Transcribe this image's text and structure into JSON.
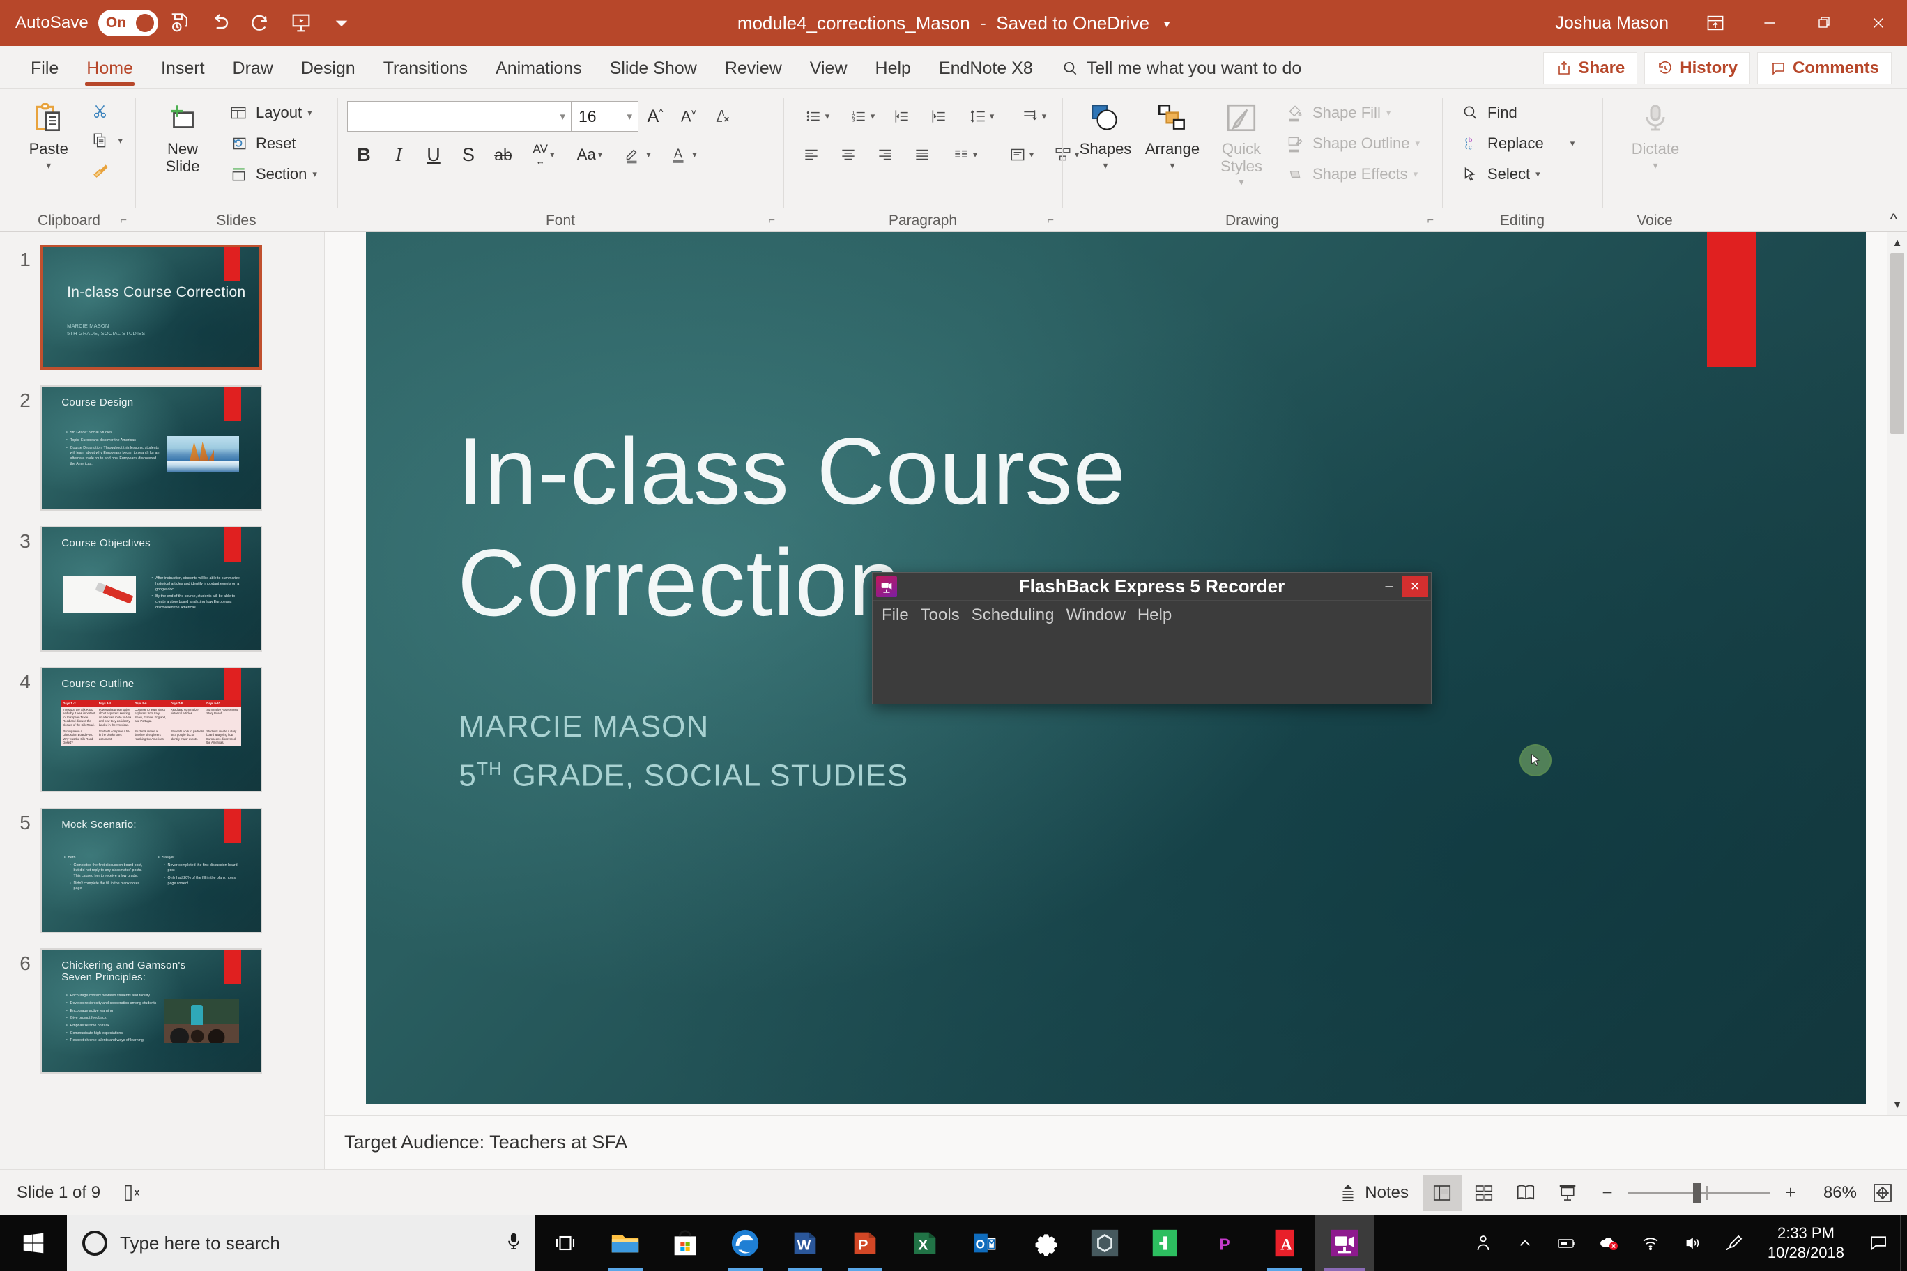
{
  "titlebar": {
    "autosave_label": "AutoSave",
    "autosave_state": "On",
    "document_title": "module4_corrections_Mason",
    "save_status": "Saved to OneDrive",
    "user_name": "Joshua Mason",
    "qat_icons": [
      "save-icon",
      "undo-icon",
      "redo-icon",
      "start-presentation-icon",
      "customize-qat-caret"
    ],
    "window_controls": [
      "ribbon-display-options",
      "minimize",
      "restore",
      "close"
    ],
    "accent_color": "#b7472a"
  },
  "tabs": [
    {
      "label": "File",
      "active": false
    },
    {
      "label": "Home",
      "active": true
    },
    {
      "label": "Insert",
      "active": false
    },
    {
      "label": "Draw",
      "active": false
    },
    {
      "label": "Design",
      "active": false
    },
    {
      "label": "Transitions",
      "active": false
    },
    {
      "label": "Animations",
      "active": false
    },
    {
      "label": "Slide Show",
      "active": false
    },
    {
      "label": "Review",
      "active": false
    },
    {
      "label": "View",
      "active": false
    },
    {
      "label": "Help",
      "active": false
    },
    {
      "label": "EndNote X8",
      "active": false
    }
  ],
  "tellme": {
    "placeholder": "Tell me what you want to do"
  },
  "header_buttons": {
    "share": "Share",
    "history": "History",
    "comments": "Comments"
  },
  "ribbon": {
    "clipboard": {
      "group_label": "Clipboard",
      "paste": "Paste",
      "cut": "cut-scissors-icon",
      "copy": "copy-icon",
      "format_painter": "format-painter-icon"
    },
    "slides": {
      "group_label": "Slides",
      "new_slide": "New Slide",
      "layout": "Layout",
      "reset": "Reset",
      "section": "Section"
    },
    "font": {
      "group_label": "Font",
      "font_name": "",
      "font_name_placeholder": "",
      "font_size": "16",
      "grow_font": "A",
      "shrink_font": "A",
      "clear_formatting": "clear-formatting-icon",
      "bold": "B",
      "italic": "I",
      "underline": "U",
      "shadow": "S",
      "strikethrough": "ab",
      "character_spacing": "AV",
      "change_case": "Aa",
      "text_highlight": "text-highlight-icon",
      "font_color": "A"
    },
    "paragraph": {
      "group_label": "Paragraph",
      "buttons": [
        "bullets-icon",
        "numbering-icon",
        "decrease-indent-icon",
        "increase-indent-icon",
        "line-spacing-icon",
        "text-direction-icon",
        "align-left-icon",
        "align-center-icon",
        "align-right-icon",
        "justify-icon",
        "columns-icon",
        "align-text-icon",
        "convert-to-smartart-icon"
      ]
    },
    "drawing": {
      "group_label": "Drawing",
      "shapes": "Shapes",
      "arrange": "Arrange",
      "quick_styles": "Quick Styles",
      "shape_fill": "Shape Fill",
      "shape_outline": "Shape Outline",
      "shape_effects": "Shape Effects"
    },
    "editing": {
      "group_label": "Editing",
      "find": "Find",
      "replace": "Replace",
      "select": "Select"
    },
    "voice": {
      "group_label": "Voice",
      "dictate": "Dictate"
    }
  },
  "thumbnails": [
    {
      "num": "1",
      "title": "In-class Course Correction",
      "subtitle1": "MARCIE MASON",
      "subtitle2": "5TH GRADE, SOCIAL STUDIES",
      "active": true,
      "kind": "title"
    },
    {
      "num": "2",
      "title": "Course Design",
      "active": false,
      "kind": "bullets-image",
      "bullets": [
        "5th Grade: Social Studies",
        "Topic: Europeans discover the Americas",
        "Course Description: Throughout this lessons, students will learn about why Europeans began to search for an alternate trade route and how Europeans discovered the Americas."
      ],
      "image": "sailing-ship-photo"
    },
    {
      "num": "3",
      "title": "Course Objectives",
      "active": false,
      "kind": "image-bullets",
      "bullets": [
        "After instruction, students will be able to summarize historical articles and identify important events on a google doc.",
        "By the end of the course, students will be able to create a story board analyzing how Europeans discovered the Americas."
      ],
      "image": "checklist-pen-photo"
    },
    {
      "num": "4",
      "title": "Course Outline",
      "active": false,
      "kind": "table",
      "table": {
        "headers": [
          "Days 1 -2",
          "Days 3-4",
          "Days 5-6",
          "Days 7-8",
          "Days 9-10"
        ],
        "rows": [
          [
            "Introduce the Silk Road and why it was important for European Trade. Read and discuss the closure of the Silk Road.",
            "Powerpoint presentation about explorers seeking an alternate route to Asia and how they accidently landed in the Americas.",
            "Continue to learn about explorers from Italy, Spain, France, England, and Portugal.",
            "Read and summarize historical articles.",
            "Summative Assessment: Story Board"
          ],
          [
            "Participate in a Discussion Board Post: Why was the Silk Road closed?",
            "Students complete a fill-in the blank notes document.",
            "Students create a timeline of explorers reaching the Americas.",
            "Students work in partners on a google doc to identify major events.",
            "Students create a story board analyzing how Europeans discovered the Americas."
          ]
        ]
      }
    },
    {
      "num": "5",
      "title": "Mock Scenario:",
      "active": false,
      "kind": "two-column",
      "left_heading": "Beth",
      "left_bullets": [
        "Completed the first discussion board post, but did not reply to any classmates' posts. This caused her to receive a low grade.",
        "Didn't complete the fill in the blank notes page"
      ],
      "right_heading": "Sawyer",
      "right_bullets": [
        "Never completed the first discussion board post",
        "Only had 20% of the fill in the blank notes page correct"
      ]
    },
    {
      "num": "6",
      "title": "Chickering and Gamson's Seven Principles:",
      "active": false,
      "kind": "numbered-image",
      "bullets": [
        "Encourage contact between students and faculty",
        "Develop reciprocity and cooperation among students",
        "Encourage active learning",
        "Give prompt feedback",
        "Emphasize time on task",
        "Communicate high expectations",
        "Respect diverse talents and ways of learning"
      ],
      "image": "classroom-teaching-photo"
    }
  ],
  "slide": {
    "title_line1": "In-class Course",
    "title_line2": "Correction",
    "subtitle_author": "MARCIE MASON",
    "subtitle_grade_prefix": "5",
    "subtitle_grade_sup": "TH",
    "subtitle_grade_rest": " GRADE, SOCIAL STUDIES"
  },
  "flashback": {
    "window_title": "FlashBack Express 5 Recorder",
    "menu": [
      "File",
      "Tools",
      "Scheduling",
      "Window",
      "Help"
    ],
    "minimize_label": "–",
    "close_label": "×"
  },
  "notes": {
    "text": "Target Audience: Teachers at SFA"
  },
  "statusbar": {
    "slide_count": "Slide 1 of 9",
    "accessibility_icon": "accessibility-checker-icon",
    "notes_button": "Notes",
    "views": [
      "normal-view-icon",
      "slide-sorter-icon",
      "reading-view-icon",
      "slide-show-icon"
    ],
    "zoom_out": "−",
    "zoom_in": "+",
    "zoom_level": "86%",
    "fit_to_window": "fit-slide-to-window-icon"
  },
  "taskbar": {
    "start": "start-windows-icon",
    "search_placeholder": "Type here to search",
    "cortana_mic": "cortana-mic-icon",
    "task_view": "task-view-icon",
    "apps": [
      {
        "name": "file-explorer-icon",
        "running": true
      },
      {
        "name": "microsoft-store-icon",
        "running": false
      },
      {
        "name": "microsoft-edge-icon",
        "running": true
      },
      {
        "name": "microsoft-word-icon",
        "running": true
      },
      {
        "name": "microsoft-powerpoint-icon",
        "running": true
      },
      {
        "name": "microsoft-excel-icon",
        "running": false
      },
      {
        "name": "microsoft-outlook-icon",
        "running": false
      },
      {
        "name": "settings-icon",
        "running": false
      },
      {
        "name": "nvidia-geforce-icon",
        "running": false
      },
      {
        "name": "evernote-icon",
        "running": false
      },
      {
        "name": "project-icon",
        "running": false
      },
      {
        "name": "adobe-acrobat-icon",
        "running": true
      },
      {
        "name": "flashback-express-icon",
        "running": true,
        "active": true
      }
    ],
    "tray": [
      "people-icon",
      "show-hidden-icons-chevron",
      "battery-icon",
      "onedrive-error-icon",
      "network-icon",
      "volume-icon",
      "pen-menu-icon"
    ],
    "clock_time": "2:33 PM",
    "clock_date": "10/28/2018",
    "action_center": "action-center-icon"
  }
}
